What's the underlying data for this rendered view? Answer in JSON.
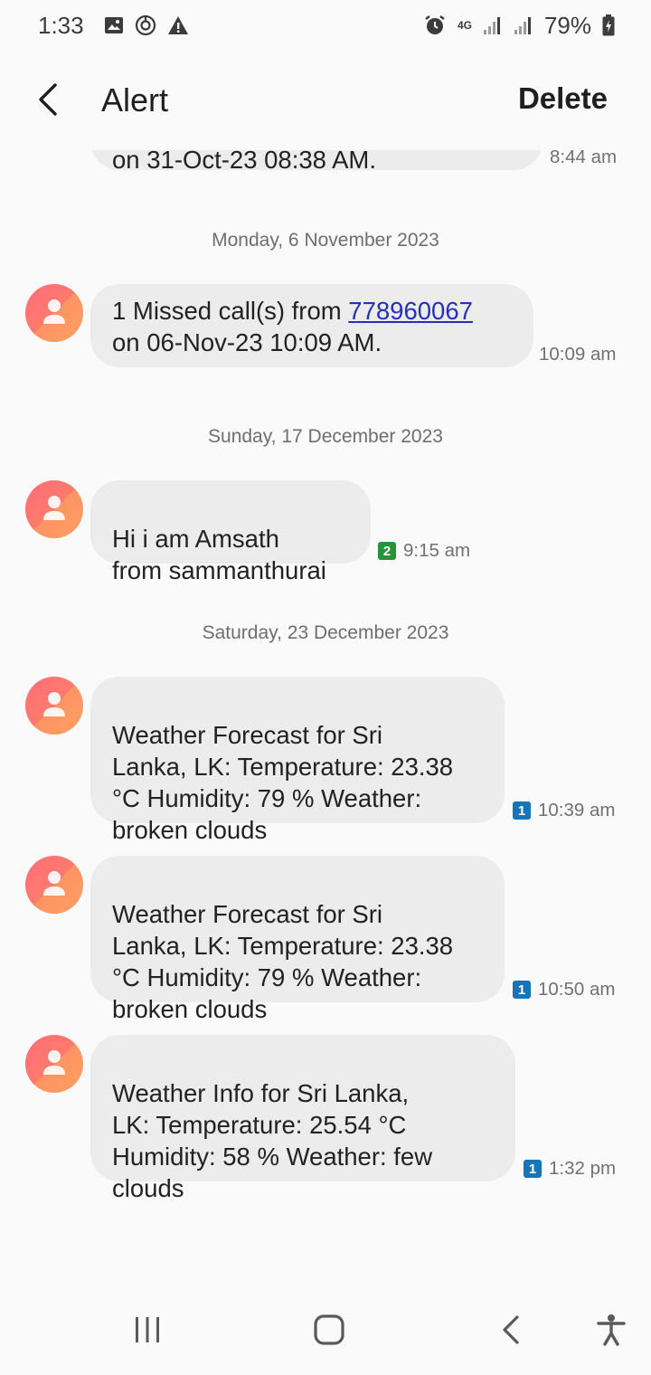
{
  "status_bar": {
    "time": "1:33",
    "left_icons": [
      "image-icon",
      "sync-icon",
      "warning-icon"
    ],
    "network": "4G",
    "battery": "79%"
  },
  "header": {
    "title": "Alert",
    "delete_label": "Delete"
  },
  "cut_message": {
    "text": "on 31-Oct-23 08:38 AM.",
    "time": "8:44 am"
  },
  "dates": [
    "Monday, 6 November 2023",
    "Sunday, 17 December 2023",
    "Saturday, 23 December 2023"
  ],
  "messages": [
    {
      "text_before": "1 Missed call(s) from ",
      "link": "778960067",
      "text_after": "\non 06-Nov-23 10:09 AM.",
      "time": "10:09 am"
    },
    {
      "text": "Hi i am Amsath\nfrom sammanthurai",
      "sim": "2",
      "time": "9:15 am"
    },
    {
      "text": "Weather Forecast for Sri\nLanka, LK: Temperature: 23.38\n°C Humidity: 79 % Weather:\nbroken clouds",
      "sim": "1",
      "time": "10:39 am"
    },
    {
      "text": "Weather Forecast for Sri\nLanka, LK: Temperature: 23.38\n°C Humidity: 79 % Weather:\nbroken clouds",
      "sim": "1",
      "time": "10:50 am"
    },
    {
      "text": "Weather Info for Sri Lanka,\nLK: Temperature: 25.54 °C\nHumidity: 58 % Weather: few\nclouds",
      "sim": "1",
      "time": "1:32 pm"
    }
  ],
  "colors": {
    "sim1": "#1675b8",
    "sim2": "#23953a",
    "bubble": "#ececec",
    "link": "#2430b8"
  },
  "nav_bar": [
    "recents-icon",
    "home-icon",
    "back-icon",
    "accessibility-icon"
  ]
}
